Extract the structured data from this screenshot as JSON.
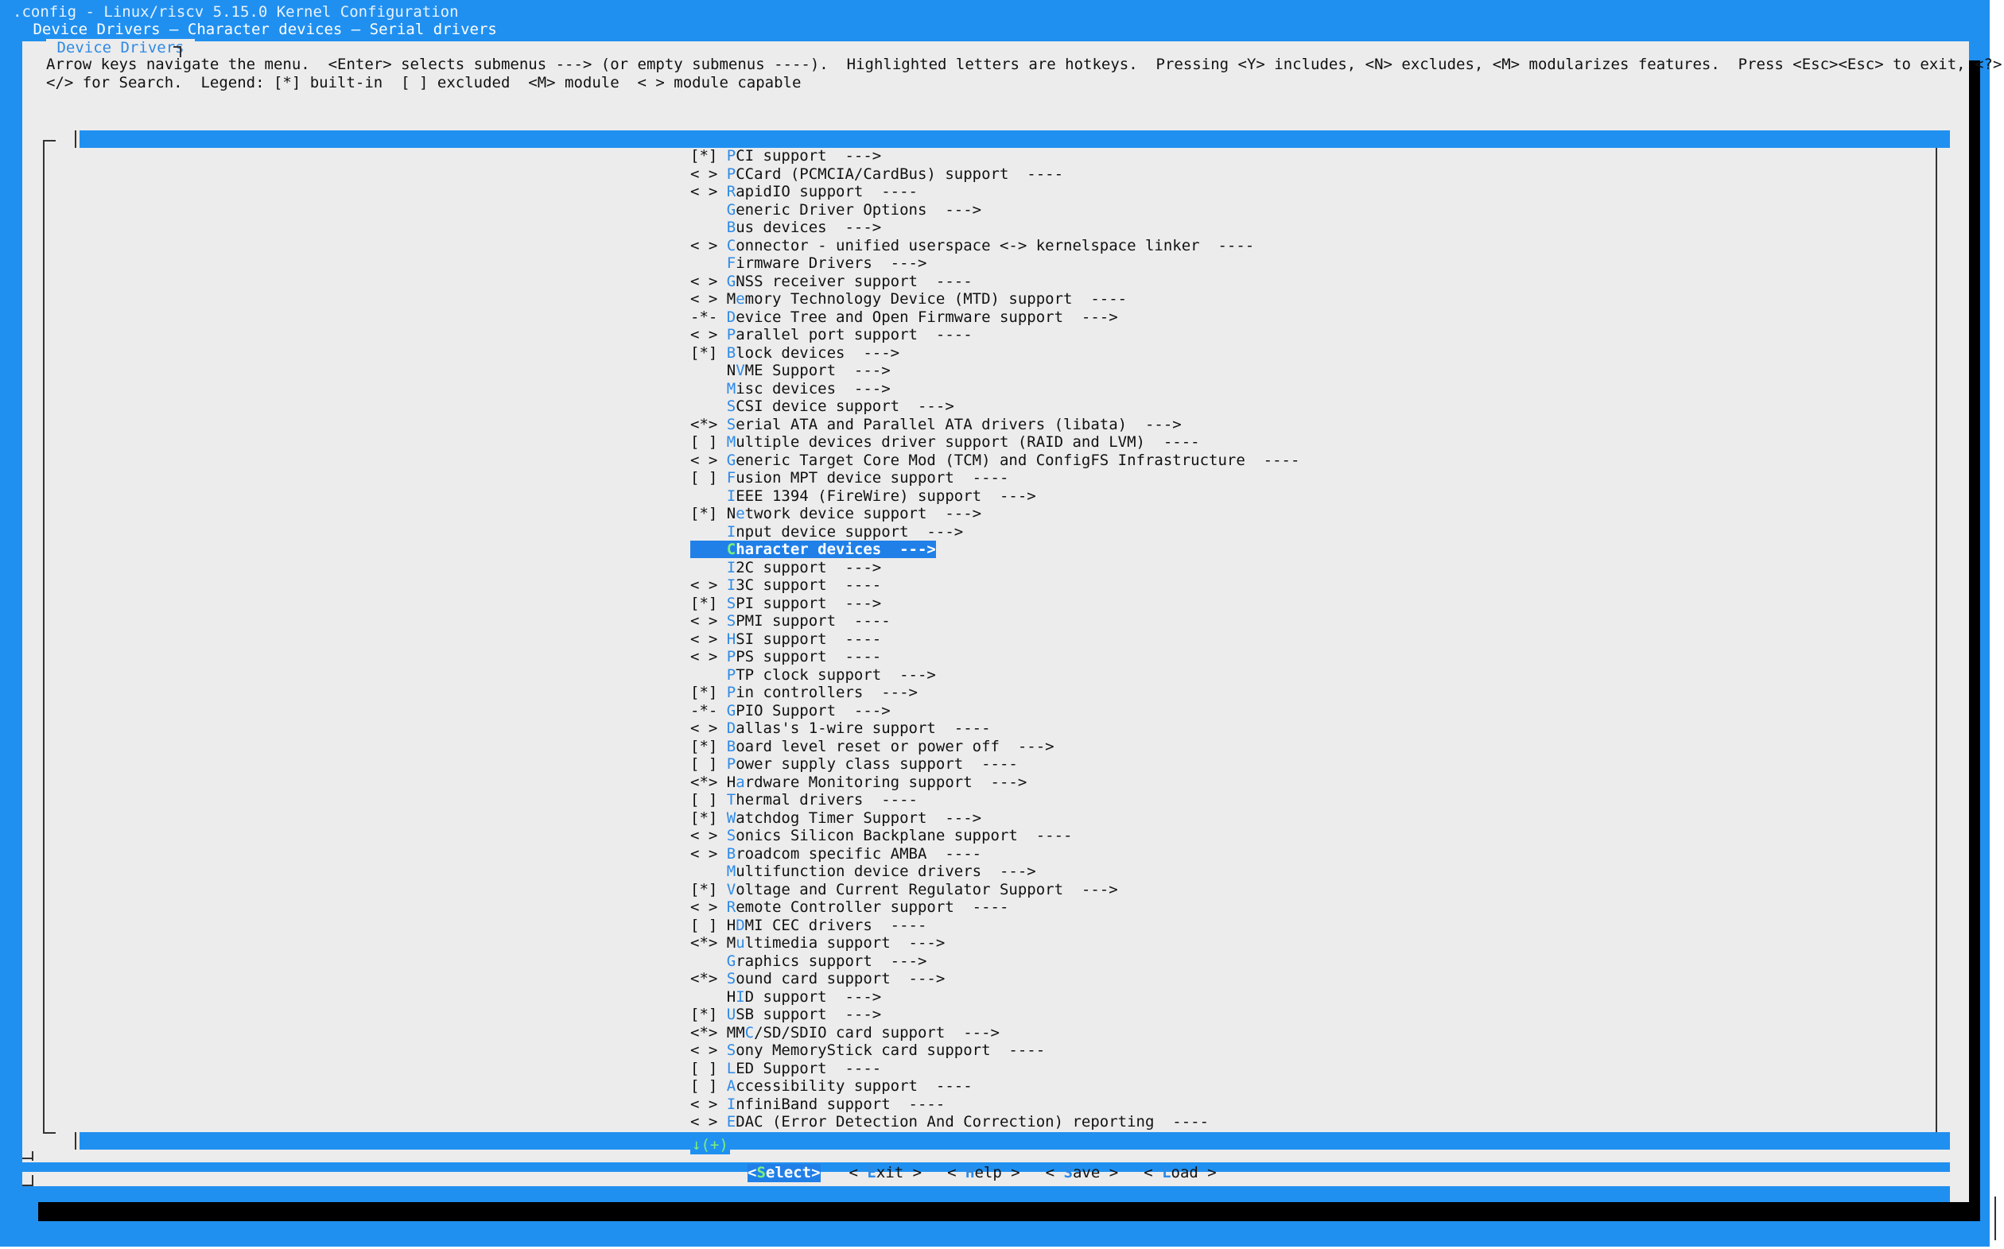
{
  "window": {
    "title_line": ".config - Linux/riscv 5.15.0 Kernel Configuration",
    "breadcrumb": " Device Drivers — Character devices — Serial drivers"
  },
  "dialog": {
    "title": " Device Drivers ",
    "help_line1": "Arrow keys navigate the menu.  <Enter> selects submenus ---> (or empty submenus ----).  Highlighted letters are hotkeys.  Pressing <Y> includes, <N> excludes, <M> modularizes features.  Press <Esc><Esc> to exit, <?> for Help,",
    "help_line2": "</> for Search.  Legend: [*] built-in  [ ] excluded  <M> module  < > module capable"
  },
  "menu_items": [
    {
      "prefix": "[*] ",
      "hotkey": "P",
      "rest": "CI support  --->"
    },
    {
      "prefix": "< > ",
      "hotkey": "P",
      "rest": "CCard (PCMCIA/CardBus) support  ----"
    },
    {
      "prefix": "< > ",
      "hotkey": "R",
      "rest": "apidIO support  ----"
    },
    {
      "prefix": "    ",
      "hotkey": "G",
      "rest": "eneric Driver Options  --->"
    },
    {
      "prefix": "    ",
      "hotkey": "B",
      "rest": "us devices  --->"
    },
    {
      "prefix": "< > ",
      "hotkey": "C",
      "rest": "onnector - unified userspace <-> kernelspace linker  ----"
    },
    {
      "prefix": "    ",
      "hotkey": "F",
      "rest": "irmware Drivers  --->"
    },
    {
      "prefix": "< > ",
      "hotkey": "G",
      "rest": "NSS receiver support  ----"
    },
    {
      "prefix": "< > M",
      "hotkey": "e",
      "rest": "mory Technology Device (MTD) support  ----"
    },
    {
      "prefix": "-*- ",
      "hotkey": "D",
      "rest": "evice Tree and Open Firmware support  --->"
    },
    {
      "prefix": "< > ",
      "hotkey": "P",
      "rest": "arallel port support  ----"
    },
    {
      "prefix": "[*] ",
      "hotkey": "B",
      "rest": "lock devices  --->"
    },
    {
      "prefix": "    N",
      "hotkey": "V",
      "rest": "ME Support  --->"
    },
    {
      "prefix": "    ",
      "hotkey": "M",
      "rest": "isc devices  --->"
    },
    {
      "prefix": "    ",
      "hotkey": "S",
      "rest": "CSI device support  --->"
    },
    {
      "prefix": "<*> ",
      "hotkey": "S",
      "rest": "erial ATA and Parallel ATA drivers (libata)  --->"
    },
    {
      "prefix": "[ ] ",
      "hotkey": "M",
      "rest": "ultiple devices driver support (RAID and LVM)  ----"
    },
    {
      "prefix": "< > ",
      "hotkey": "G",
      "rest": "eneric Target Core Mod (TCM) and ConfigFS Infrastructure  ----"
    },
    {
      "prefix": "[ ] ",
      "hotkey": "F",
      "rest": "usion MPT device support  ----"
    },
    {
      "prefix": "    ",
      "hotkey": "I",
      "rest": "EEE 1394 (FireWire) support  --->"
    },
    {
      "prefix": "[*] N",
      "hotkey": "e",
      "rest": "twork device support  --->"
    },
    {
      "prefix": "    ",
      "hotkey": "I",
      "rest": "nput device support  --->"
    },
    {
      "prefix": "    ",
      "hotkey": "C",
      "rest": "haracter devices  --->",
      "selected": true
    },
    {
      "prefix": "    ",
      "hotkey": "I",
      "rest": "2C support  --->"
    },
    {
      "prefix": "< > ",
      "hotkey": "I",
      "rest": "3C support  ----"
    },
    {
      "prefix": "[*] ",
      "hotkey": "S",
      "rest": "PI support  --->"
    },
    {
      "prefix": "< > ",
      "hotkey": "S",
      "rest": "PMI support  ----"
    },
    {
      "prefix": "< > ",
      "hotkey": "H",
      "rest": "SI support  ----"
    },
    {
      "prefix": "< > ",
      "hotkey": "P",
      "rest": "PS support  ----"
    },
    {
      "prefix": "    ",
      "hotkey": "P",
      "rest": "TP clock support  --->"
    },
    {
      "prefix": "[*] ",
      "hotkey": "P",
      "rest": "in controllers  --->"
    },
    {
      "prefix": "-*- ",
      "hotkey": "G",
      "rest": "PIO Support  --->"
    },
    {
      "prefix": "< > ",
      "hotkey": "D",
      "rest": "allas's 1-wire support  ----"
    },
    {
      "prefix": "[*] ",
      "hotkey": "B",
      "rest": "oard level reset or power off  --->"
    },
    {
      "prefix": "[ ] ",
      "hotkey": "P",
      "rest": "ower supply class support  ----"
    },
    {
      "prefix": "<*> H",
      "hotkey": "a",
      "rest": "rdware Monitoring support  --->"
    },
    {
      "prefix": "[ ] ",
      "hotkey": "T",
      "rest": "hermal drivers  ----"
    },
    {
      "prefix": "[*] ",
      "hotkey": "W",
      "rest": "atchdog Timer Support  --->"
    },
    {
      "prefix": "< > ",
      "hotkey": "S",
      "rest": "onics Silicon Backplane support  ----"
    },
    {
      "prefix": "< > ",
      "hotkey": "B",
      "rest": "roadcom specific AMBA  ----"
    },
    {
      "prefix": "    ",
      "hotkey": "M",
      "rest": "ultifunction device drivers  --->"
    },
    {
      "prefix": "[*] ",
      "hotkey": "V",
      "rest": "oltage and Current Regulator Support  --->"
    },
    {
      "prefix": "< > ",
      "hotkey": "R",
      "rest": "emote Controller support  ----"
    },
    {
      "prefix": "[ ] H",
      "hotkey": "D",
      "rest": "MI CEC drivers  ----"
    },
    {
      "prefix": "<*> M",
      "hotkey": "u",
      "rest": "ltimedia support  --->"
    },
    {
      "prefix": "    ",
      "hotkey": "G",
      "rest": "raphics support  --->"
    },
    {
      "prefix": "<*> ",
      "hotkey": "S",
      "rest": "ound card support  --->"
    },
    {
      "prefix": "    H",
      "hotkey": "I",
      "rest": "D support  --->"
    },
    {
      "prefix": "[*] ",
      "hotkey": "U",
      "rest": "SB support  --->"
    },
    {
      "prefix": "<*> MM",
      "hotkey": "C",
      "rest": "/SD/SDIO card support  --->"
    },
    {
      "prefix": "< > ",
      "hotkey": "S",
      "rest": "ony MemoryStick card support  ----"
    },
    {
      "prefix": "[ ] ",
      "hotkey": "L",
      "rest": "ED Support  ----"
    },
    {
      "prefix": "[ ] ",
      "hotkey": "A",
      "rest": "ccessibility support  ----"
    },
    {
      "prefix": "< > ",
      "hotkey": "I",
      "rest": "nfiniBand support  ----"
    },
    {
      "prefix": "< > ",
      "hotkey": "E",
      "rest": "DAC (Error Detection And Correction) reporting  ----"
    }
  ],
  "more_indicator": "↓(+)",
  "buttons": [
    {
      "pre": "<",
      "hk": "S",
      "post": "elect>",
      "active": true
    },
    {
      "pre": "< ",
      "hk": "E",
      "post": "xit >"
    },
    {
      "pre": "< ",
      "hk": "H",
      "post": "elp >"
    },
    {
      "pre": "< ",
      "hk": "S",
      "post": "ave >"
    },
    {
      "pre": "< ",
      "hk": "L",
      "post": "oad >"
    }
  ]
}
